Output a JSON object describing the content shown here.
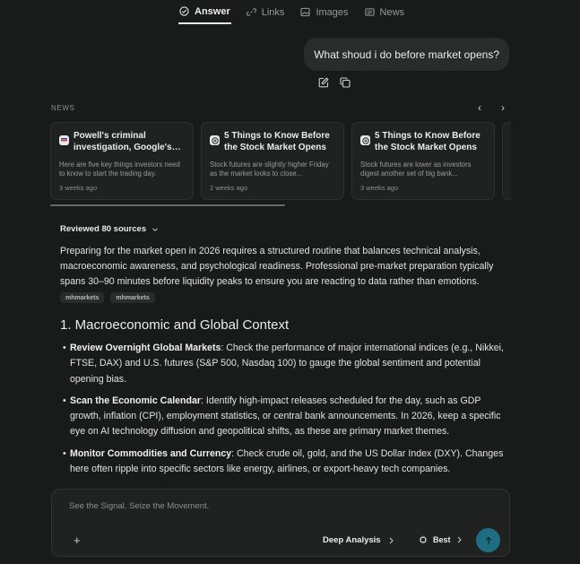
{
  "tabs": [
    {
      "label": "Answer",
      "icon": "answer-icon"
    },
    {
      "label": "Links",
      "icon": "link-icon"
    },
    {
      "label": "Images",
      "icon": "image-icon"
    },
    {
      "label": "News",
      "icon": "news-icon"
    }
  ],
  "query": "What shoud i do before market opens?",
  "news": {
    "label": "NEWS",
    "cards": [
      {
        "title": "Powell's criminal investigation, Google's AI...",
        "description": "Here are five key things investors need to know to start the trading day.",
        "time": "3 weeks ago"
      },
      {
        "title": "5 Things to Know Before the Stock Market Opens",
        "description": "Stock futures are slightly higher Friday as the market looks to close...",
        "time": "2 weeks ago"
      },
      {
        "title": "5 Things to Know Before the Stock Market Opens",
        "description": "Stock futures are lower as investors digest another set of big bank...",
        "time": "3 weeks ago"
      }
    ]
  },
  "answer": {
    "reviewed": "Reviewed 80 sources",
    "intro": "Preparing for the market open in 2026 requires a structured routine that balances technical analysis, macroeconomic awareness, and psychological readiness. Professional pre-market preparation typically spans 30–90 minutes before liquidity peaks to ensure you are reacting to data rather than emotions.",
    "chips": [
      "mhmarkets",
      "mhmarkets"
    ],
    "heading": "1. Macroeconomic and Global Context",
    "bullets": [
      {
        "bold": "Review Overnight Global Markets",
        "text": ": Check the performance of major international indices (e.g., Nikkei, FTSE, DAX) and U.S. futures (S&P 500, Nasdaq 100) to gauge the global sentiment and potential opening bias."
      },
      {
        "bold": "Scan the Economic Calendar",
        "text": ": Identify high-impact releases scheduled for the day, such as GDP growth, inflation (CPI), employment statistics, or central bank announcements. In 2026, keep a specific eye on AI technology diffusion and geopolitical shifts, as these are primary market themes."
      },
      {
        "bold": "Monitor Commodities and Currency",
        "text": ": Check crude oil, gold, and the US Dollar Index (DXY). Changes here often ripple into specific sectors like energy, airlines, or export-heavy tech companies."
      }
    ]
  },
  "composer": {
    "placeholder": "See the Signal. Seize the Movement.",
    "plus": "+",
    "mode": "Deep Analysis",
    "model": "Best"
  },
  "colors": {
    "background": "#191a1a",
    "send_button": "#1f6d82"
  }
}
